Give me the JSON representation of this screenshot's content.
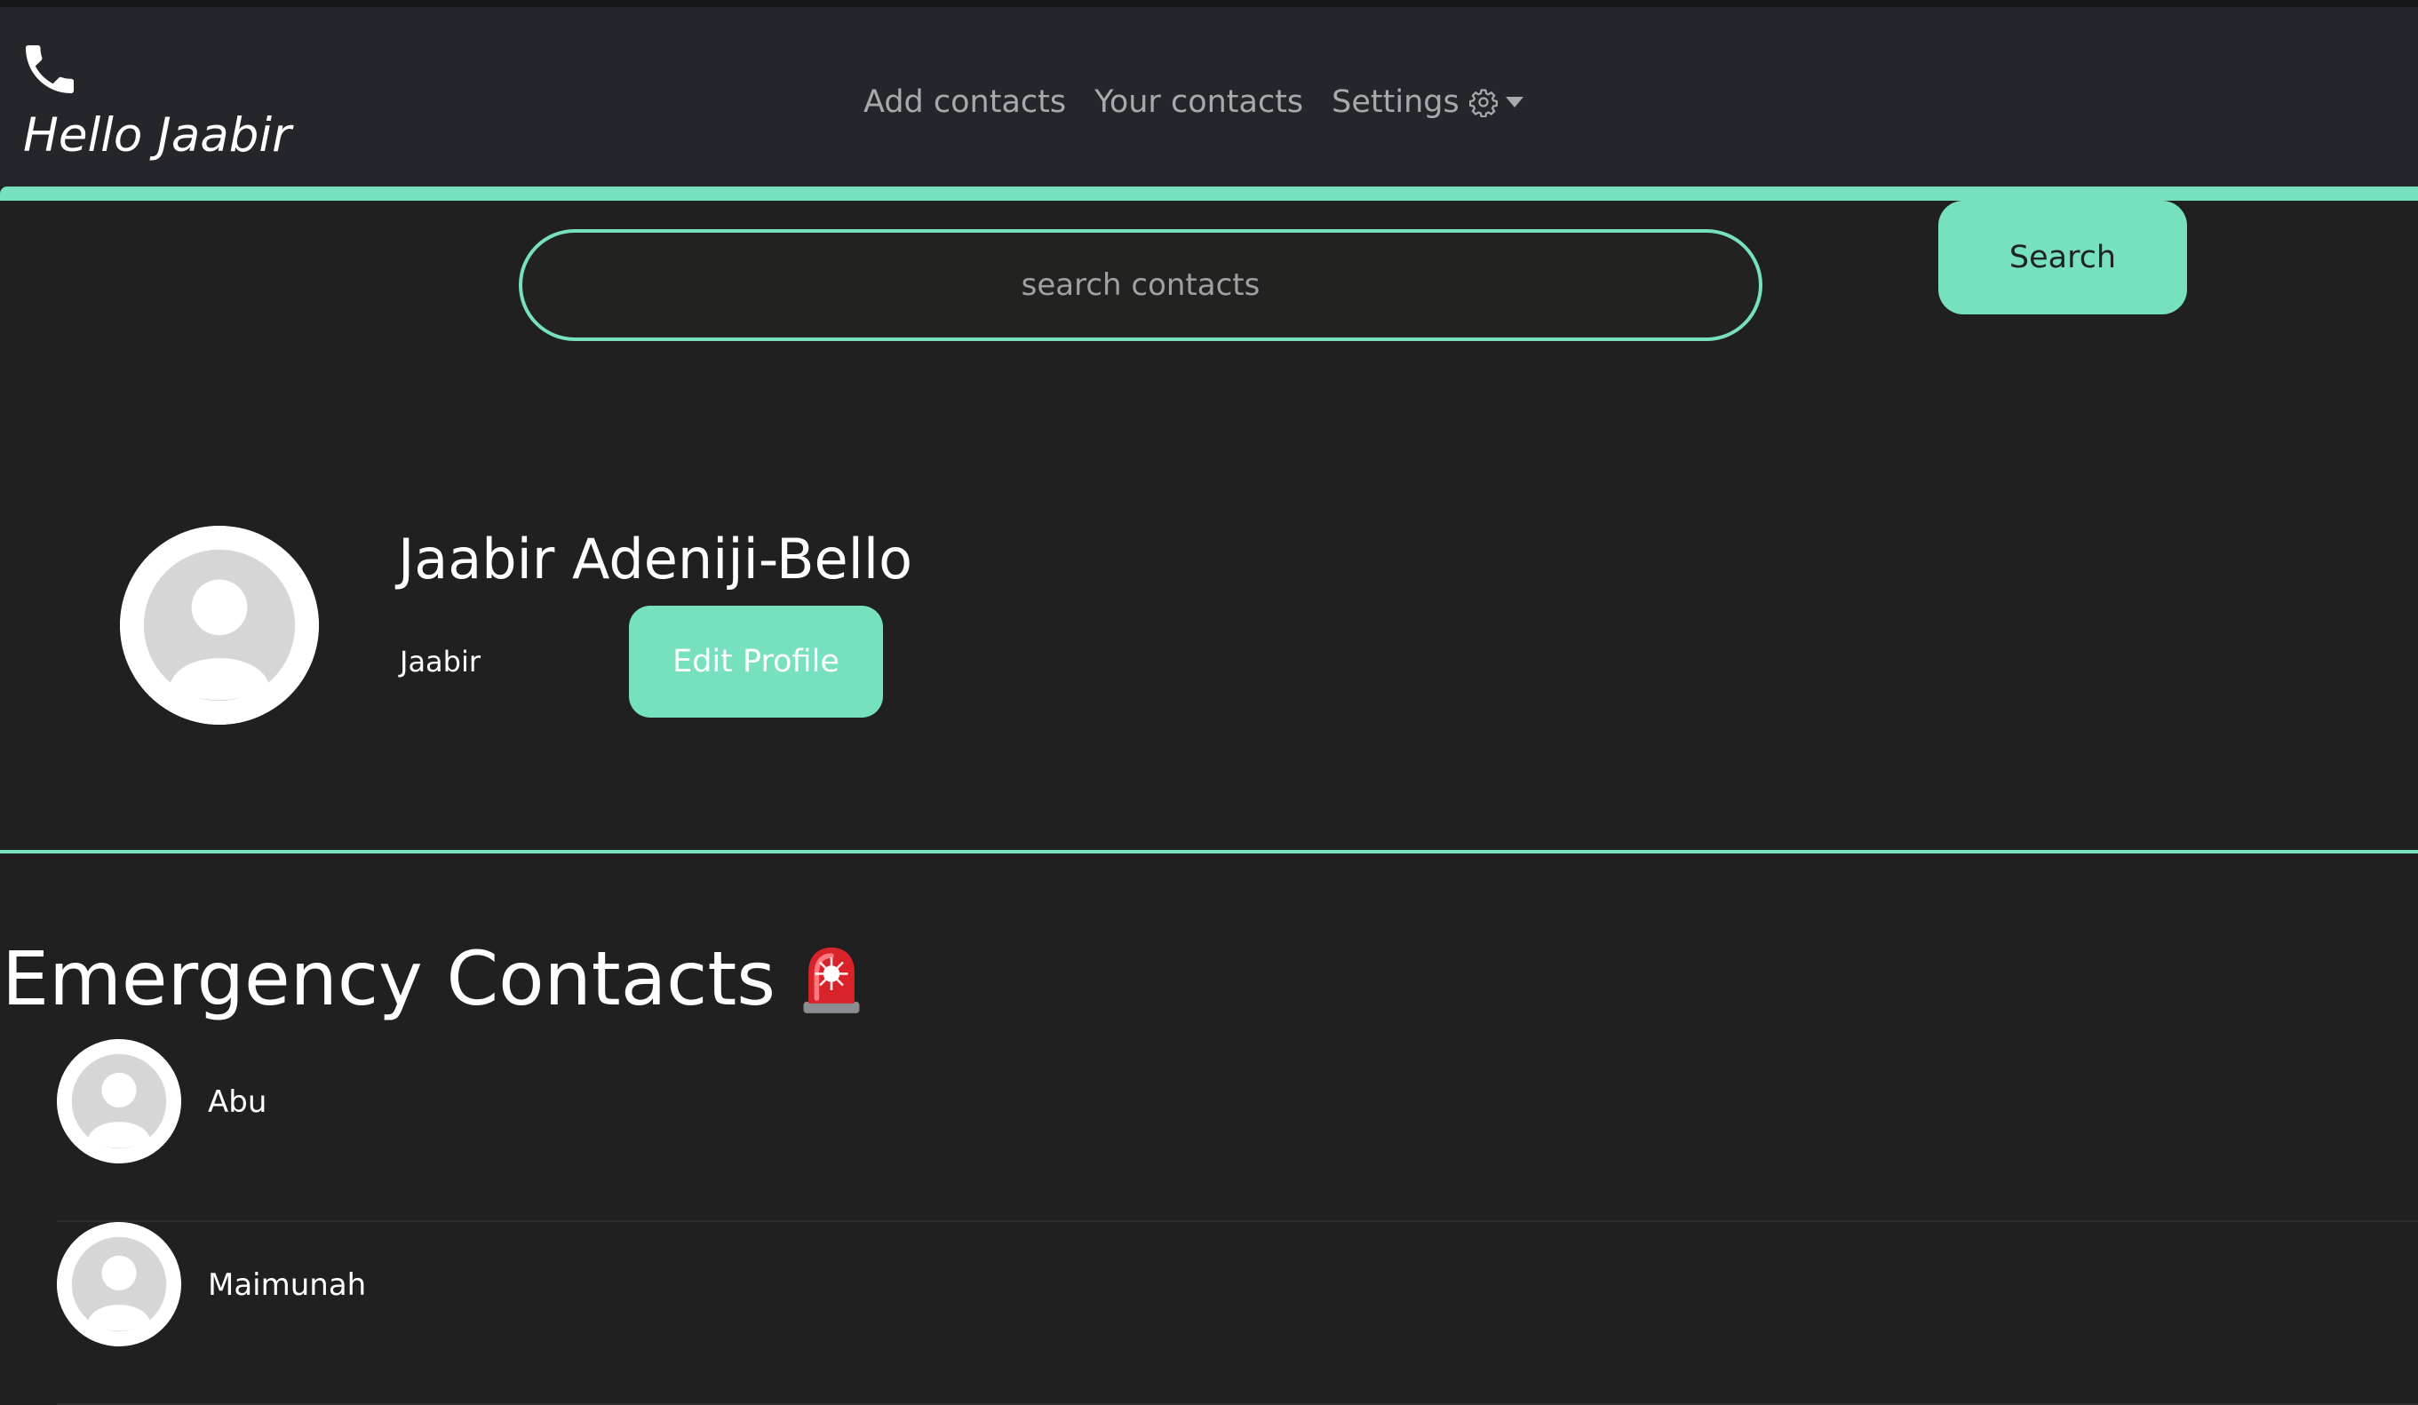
{
  "header": {
    "greeting": "Hello Jaabir",
    "nav": {
      "add_contacts": "Add contacts",
      "your_contacts": "Your contacts",
      "settings": "Settings"
    }
  },
  "search": {
    "placeholder": "search contacts",
    "value": "",
    "button_label": "Search"
  },
  "profile": {
    "full_name": "Jaabir Adeniji-Bello",
    "username": "Jaabir",
    "edit_label": "Edit Profile"
  },
  "emergency": {
    "title": "Emergency Contacts",
    "icon": "siren-icon",
    "contacts": [
      {
        "name": "Abu"
      },
      {
        "name": "Maimunah"
      }
    ]
  },
  "colors": {
    "accent": "#76e0bf",
    "background": "#202020",
    "navbar": "#24262b",
    "nav_text": "#a7a9ad"
  }
}
